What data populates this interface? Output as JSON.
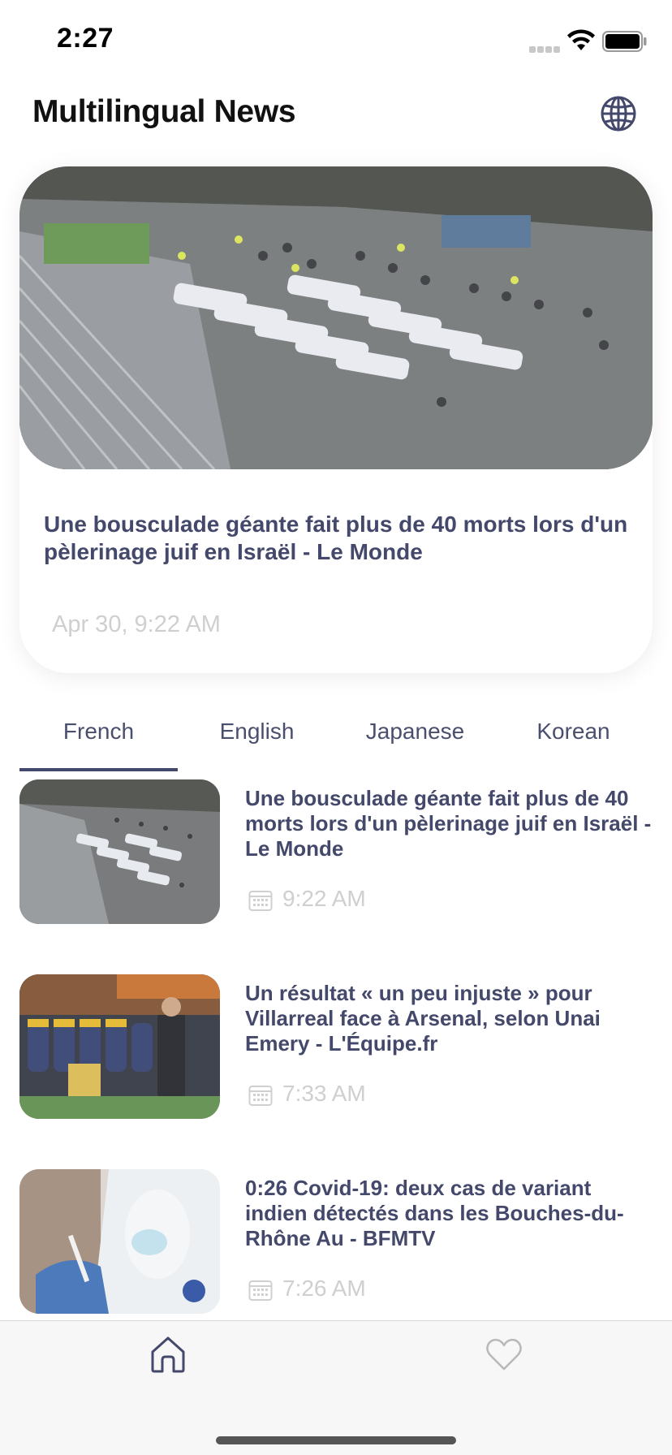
{
  "status_bar": {
    "time": "2:27"
  },
  "header": {
    "title": "Multilingual News",
    "language_icon": "globe-icon"
  },
  "featured": {
    "title": "Une bousculade géante fait plus de 40 morts lors d'un pèlerinage juif en Israël - Le Monde",
    "date": "Apr 30, 9:22 AM"
  },
  "tabs": [
    {
      "label": "French",
      "selected": true
    },
    {
      "label": "English",
      "selected": false
    },
    {
      "label": "Japanese",
      "selected": false
    },
    {
      "label": "Korean",
      "selected": false
    }
  ],
  "articles": [
    {
      "title": "Une bousculade géante fait plus de 40 morts lors d'un pèlerinage juif en Israël - Le Monde",
      "time": "9:22 AM",
      "icon": "calendar-icon"
    },
    {
      "title": "Un résultat « un peu injuste » pour Villarreal face à Arsenal, selon Unai Emery - L'Équipe.fr",
      "time": "7:33 AM",
      "icon": "calendar-icon"
    },
    {
      "title": "0:26 Covid-19: deux cas de variant indien détectés dans les Bouches-du-Rhône Au - BFMTV",
      "time": "7:26 AM",
      "icon": "calendar-icon"
    }
  ],
  "bottom_nav": {
    "items": [
      {
        "icon": "home-icon",
        "selected": true
      },
      {
        "icon": "heart-icon",
        "selected": false
      }
    ]
  },
  "colors": {
    "accent": "#44496c",
    "muted": "#cfcfcf"
  }
}
